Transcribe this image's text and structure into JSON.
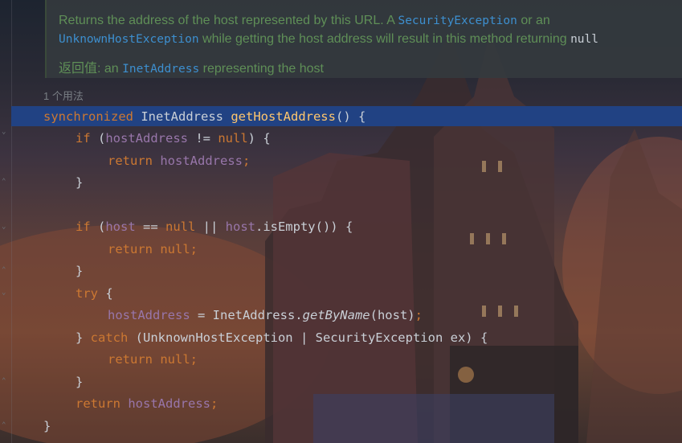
{
  "doc": {
    "line1_text": "Returns the address of the host represented by this URL. A ",
    "line1_code": "SecurityException",
    "line1_end": " or an",
    "line2_code": "UnknownHostException",
    "line2_text": " while getting the host address will result in this method returning ",
    "line2_null": "null",
    "line3_label": "返回值: ",
    "line3_text_a": "an ",
    "line3_code": "InetAddress",
    "line3_text_b": " representing the host"
  },
  "usage_hint": "1 个用法",
  "code": {
    "l1": {
      "kw": "synchronized",
      "type": "InetAddress",
      "name": "getHostAddress",
      "rest": "() {"
    },
    "l2": {
      "kw": "if",
      "a": " (",
      "fld": "hostAddress",
      "b": " != ",
      "kw2": "null",
      "c": ") {"
    },
    "l3": {
      "kw": "return",
      "fld": " hostAddress",
      "semi": ";"
    },
    "l4": "}",
    "l6": {
      "kw": "if",
      "a": " (",
      "fld": "host",
      "b": " == ",
      "kw2": "null",
      "c": " || ",
      "fld2": "host",
      "d": ".isEmpty()) {"
    },
    "l7": {
      "kw": "return",
      "kw2": " null",
      "semi": ";"
    },
    "l8": "}",
    "l9": {
      "kw": "try",
      "rest": " {"
    },
    "l10": {
      "fld": "hostAddress",
      "a": " = InetAddress.",
      "call": "getByName",
      "b": "(host)",
      "semi": ";"
    },
    "l11": {
      "a": "} ",
      "kw": "catch",
      "b": " (UnknownHostException | SecurityException ex) {"
    },
    "l12": {
      "kw": "return",
      "kw2": " null",
      "semi": ";"
    },
    "l13": "}",
    "l14": {
      "kw": "return",
      "fld": " hostAddress",
      "semi": ";"
    },
    "l15": "}"
  },
  "colors": {
    "keyword": "#cc7832",
    "field": "#9876aa",
    "method": "#ffc66d",
    "doc_text": "#5f8f57",
    "doc_code": "#3d8fcf",
    "selection": "#214283"
  },
  "icons": [
    "fold-marker-icon"
  ]
}
